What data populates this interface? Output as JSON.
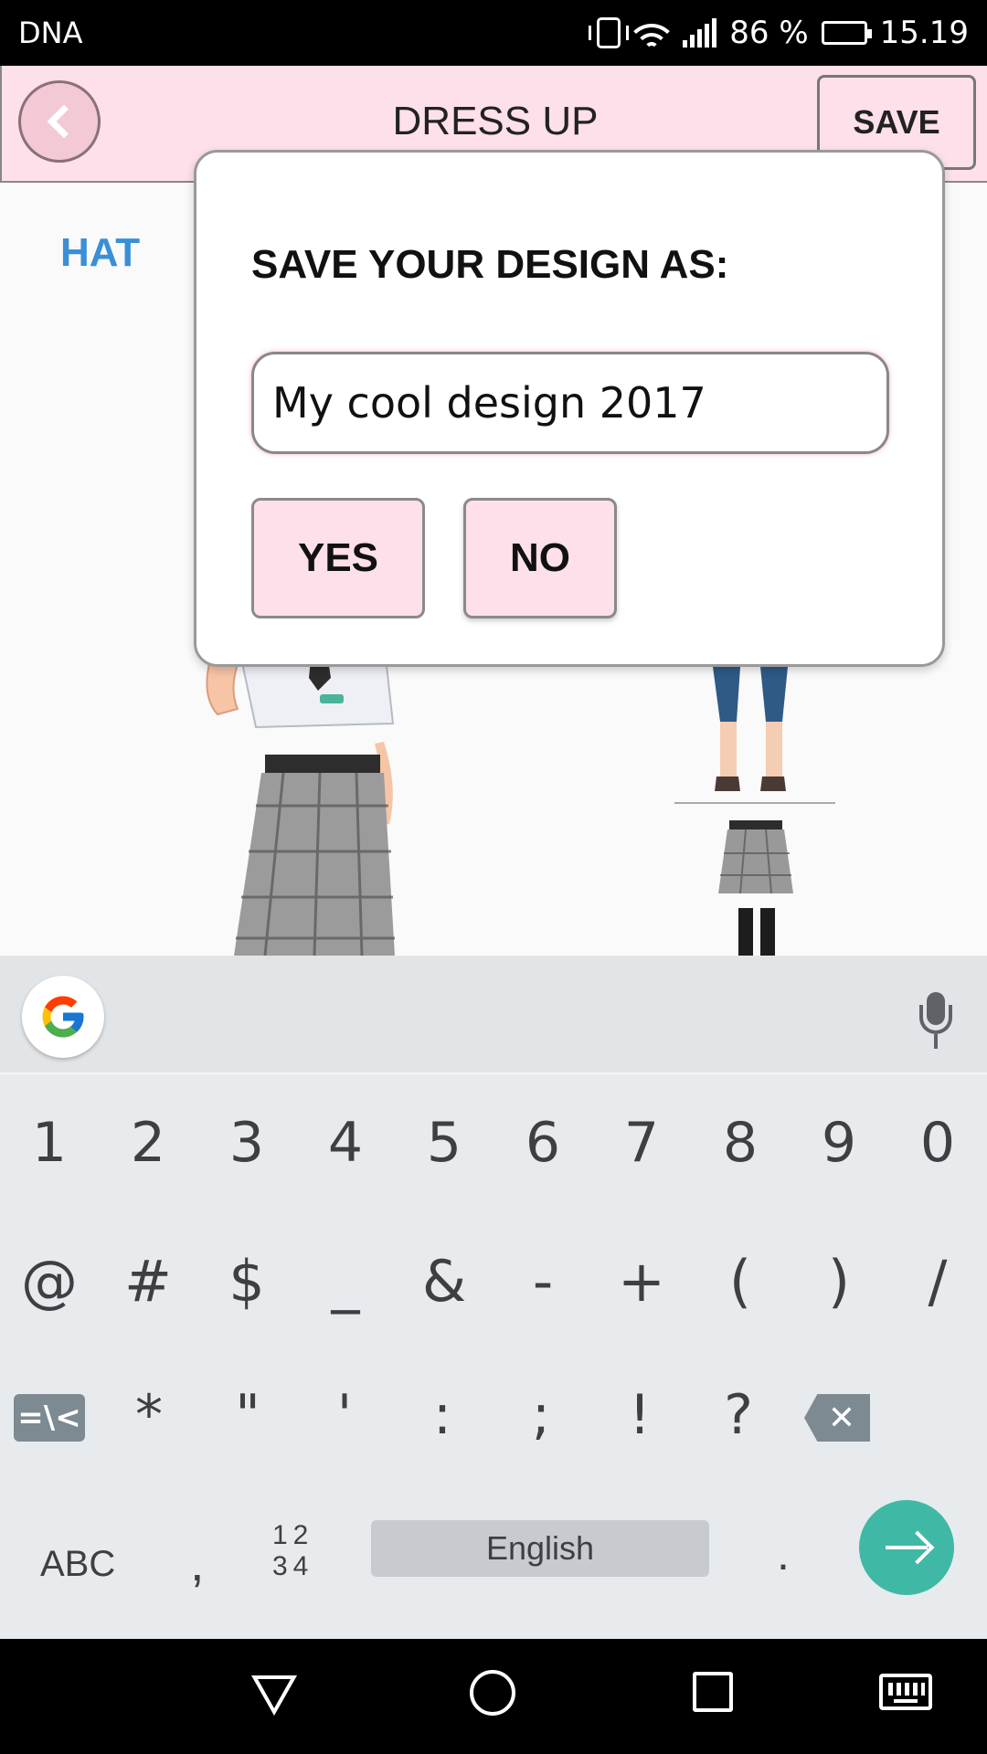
{
  "status_bar": {
    "carrier": "DNA",
    "battery": "86 %",
    "battery_level": 0.86,
    "time": "15.19"
  },
  "header": {
    "title": "DRESS UP",
    "save_label": "SAVE"
  },
  "content": {
    "category_tab": "HAT"
  },
  "dialog": {
    "title": "SAVE YOUR DESIGN AS:",
    "input_value": "My cool design 2017",
    "yes_label": "YES",
    "no_label": "NO"
  },
  "keyboard": {
    "row1": [
      "1",
      "2",
      "3",
      "4",
      "5",
      "6",
      "7",
      "8",
      "9",
      "0"
    ],
    "row2": [
      "@",
      "#",
      "$",
      "_",
      "&",
      "-",
      "+",
      "(",
      ")",
      "/"
    ],
    "row3_symbols_label": "=\\<",
    "row3": [
      "*",
      "\"",
      "'",
      ":",
      ";",
      "!",
      "?"
    ],
    "abc_label": "ABC",
    "comma": ",",
    "num_toggle_top": "12",
    "num_toggle_bottom": "34",
    "space_label": "English",
    "period": "."
  },
  "icons": {
    "back": "chevron-left-icon",
    "google": "google-icon",
    "mic": "microphone-icon",
    "enter": "arrow-right-icon",
    "backspace": "backspace-icon"
  },
  "colors": {
    "header_bg": "#fde0ea",
    "accent_blue": "#3a8fd6",
    "enter_key": "#3fb9a5"
  }
}
